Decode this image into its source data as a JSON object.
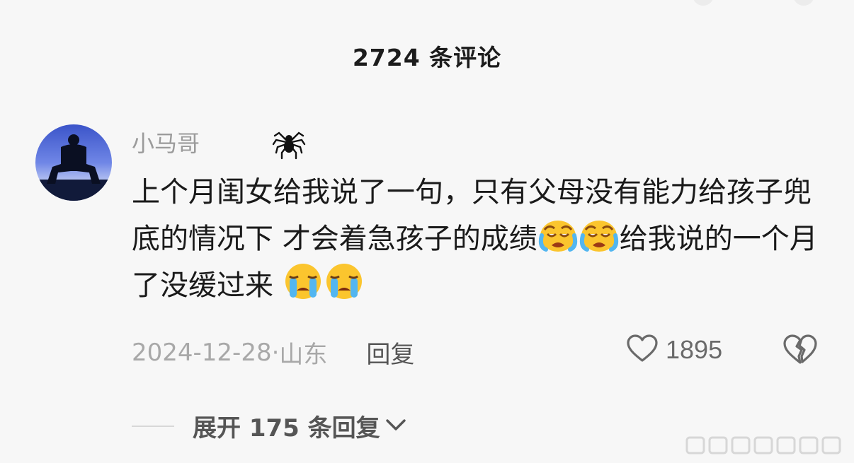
{
  "header": {
    "title": "2724 条评论"
  },
  "comment": {
    "username": "小马哥",
    "badge_icon": "spider-icon",
    "text_parts": [
      "上个月闺女给我说了一句，只有父母没有能力给孩子兜底的情况下 才会着急孩子的成绩",
      "给我说的一个月了没缓过来 "
    ],
    "emojis": [
      "crying-face-emoji",
      "loudly-crying-face-emoji"
    ],
    "date": "2024-12-28·",
    "location": "山东",
    "reply_label": "回复",
    "like_count": "1895"
  },
  "replies": {
    "expand_label": "展开 175 条回复"
  },
  "colors": {
    "background": "#f7f7f7",
    "username": "#9b9b9b",
    "meta": "#a8a8a8",
    "text": "#1a1a1a"
  }
}
